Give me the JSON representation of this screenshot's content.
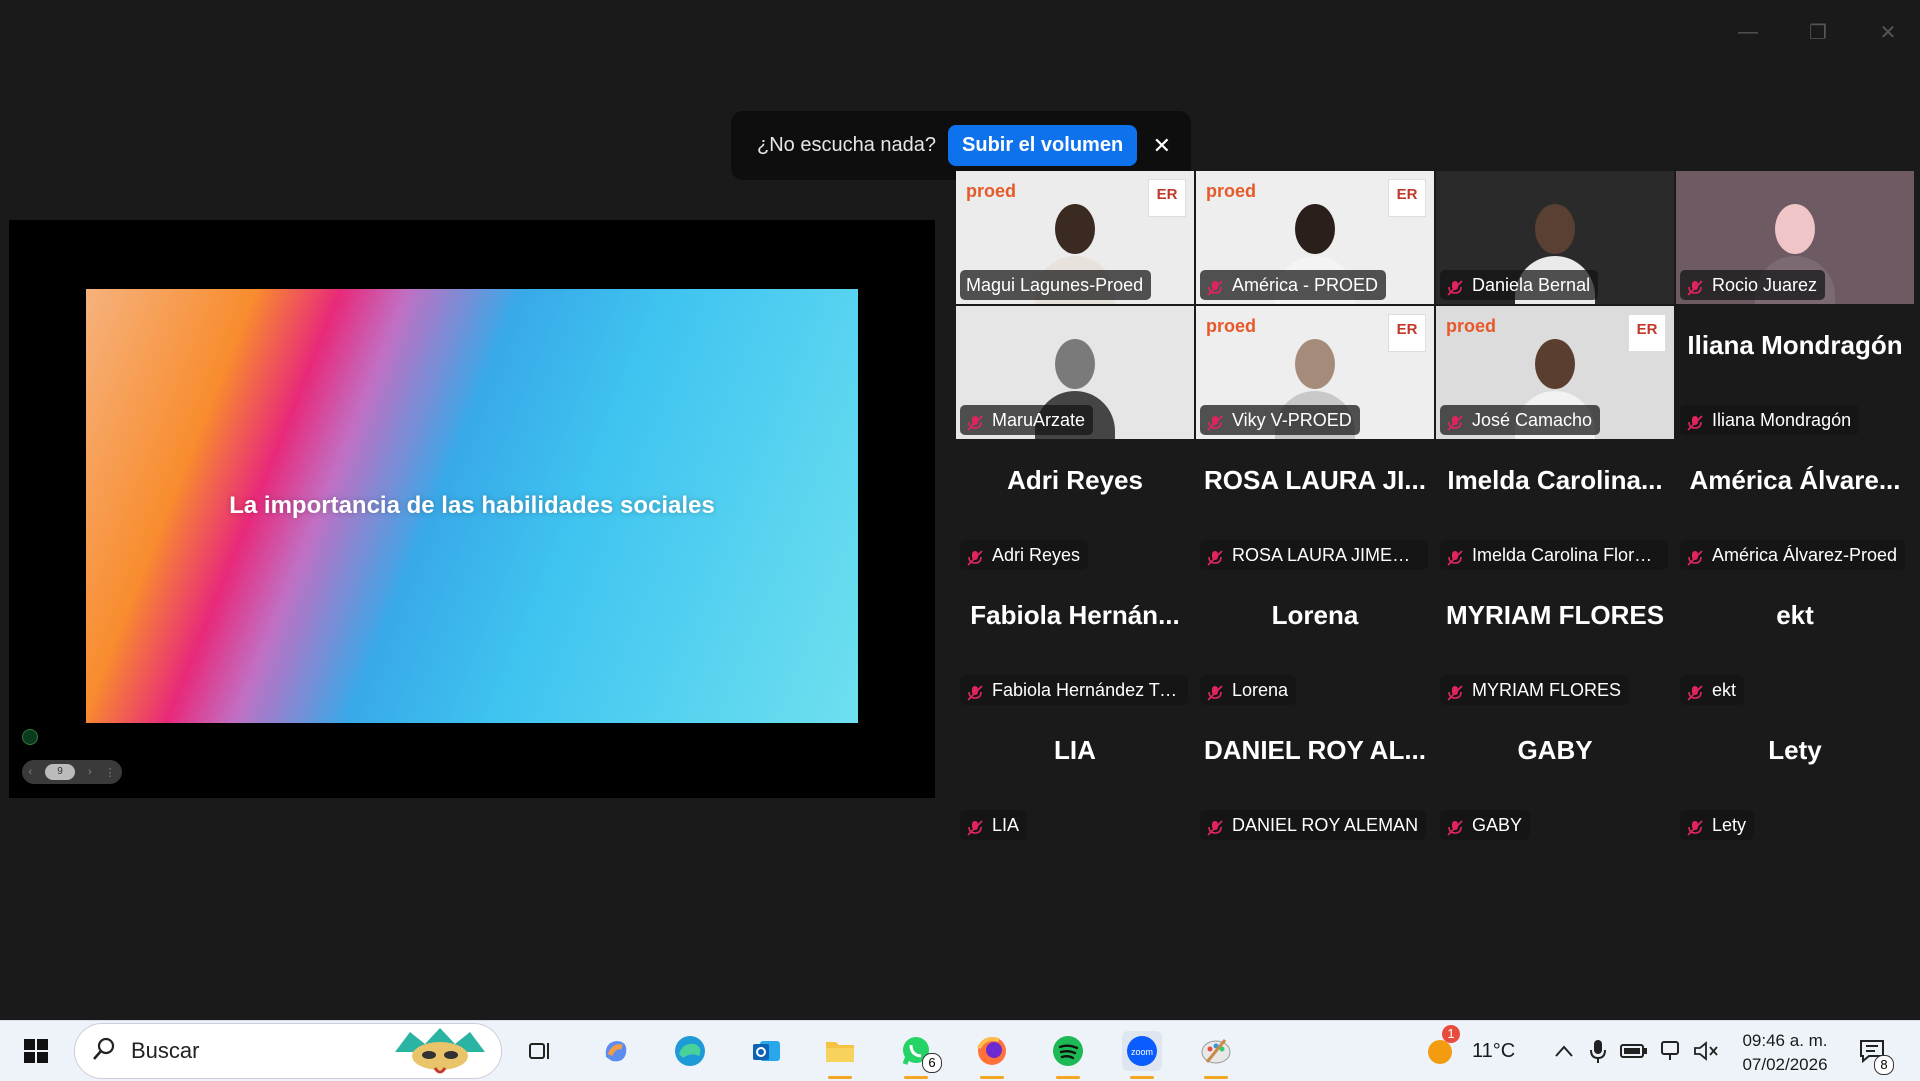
{
  "toast": {
    "message": "¿No escucha nada?",
    "button_label": "Subir el volumen",
    "close_glyph": "✕"
  },
  "share": {
    "slide_title": "La importancia de las habilidades sociales",
    "nav_page": "9"
  },
  "participants": [
    {
      "name": "Magui Lagunes-Proed",
      "video": true,
      "active": true,
      "muted": false,
      "logos": true
    },
    {
      "name": "América - PROED",
      "video": true,
      "muted": true,
      "logos": true
    },
    {
      "name": "Daniela Bernal",
      "video": true,
      "muted": true
    },
    {
      "name": "Rocio Juarez",
      "video": true,
      "muted": true
    },
    {
      "name": "MaruArzate",
      "video": true,
      "muted": true
    },
    {
      "name": "Viky V-PROED",
      "video": true,
      "muted": true,
      "logos": true
    },
    {
      "name": "José Camacho",
      "video": true,
      "muted": true,
      "logos": true
    },
    {
      "name": "Iliana Mondragón",
      "display": "Iliana Mondragón",
      "video": false,
      "muted": true
    },
    {
      "name": "Adri Reyes",
      "display": "Adri Reyes",
      "video": false,
      "muted": true
    },
    {
      "name": "ROSA LAURA JIMENEZ...",
      "display": "ROSA LAURA JI...",
      "video": false,
      "muted": true
    },
    {
      "name": "Imelda Carolina Flores...",
      "display": "Imelda Carolina...",
      "video": false,
      "muted": true
    },
    {
      "name": "América Álvarez-Proed",
      "display": "América Álvare...",
      "video": false,
      "muted": true
    },
    {
      "name": "Fabiola Hernández Trejo",
      "display": "Fabiola Hernán...",
      "video": false,
      "muted": true
    },
    {
      "name": "Lorena",
      "display": "Lorena",
      "video": false,
      "muted": true
    },
    {
      "name": "MYRIAM FLORES",
      "display": "MYRIAM FLORES",
      "video": false,
      "muted": true
    },
    {
      "name": "ekt",
      "display": "ekt",
      "video": false,
      "muted": true
    },
    {
      "name": "LIA",
      "display": "LIA",
      "video": false,
      "muted": true
    },
    {
      "name": "DANIEL ROY ALEMAN",
      "display": "DANIEL ROY AL...",
      "video": false,
      "muted": true
    },
    {
      "name": "GABY",
      "display": "GABY",
      "video": false,
      "muted": true
    },
    {
      "name": "Lety",
      "display": "Lety",
      "video": false,
      "muted": true
    }
  ],
  "logo_proed": "proed",
  "logo_er": "ER",
  "taskbar": {
    "search_placeholder": "Buscar",
    "whatsapp_badge": "6",
    "weather_alert": "1",
    "temperature": "11°C",
    "time": "09:46 a. m.",
    "date": "07/02/2026",
    "notifications": "8"
  },
  "colors": {
    "accent": "#0e72ed",
    "active_speaker": "#23d959",
    "muted_icon": "#e0245e"
  }
}
